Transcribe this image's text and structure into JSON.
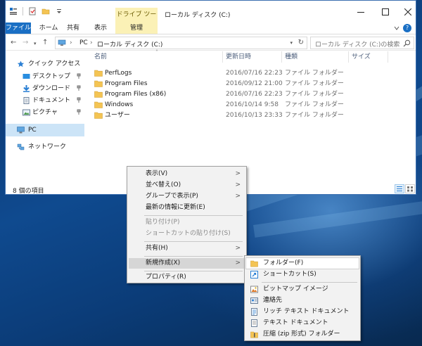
{
  "window": {
    "title": "ローカル ディスク (C:)",
    "contextual_tab": "ドライブ ツール"
  },
  "ribbon": {
    "tabs": [
      "ファイル",
      "ホーム",
      "共有",
      "表示",
      "管理"
    ],
    "help": "?"
  },
  "address": {
    "crumbs": [
      "›",
      "PC",
      "›",
      "ローカル ディスク (C:)"
    ],
    "search_placeholder": "ローカル ディスク (C:)の検索"
  },
  "nav_pane": {
    "items": [
      {
        "label": "クイック アクセス",
        "icon": "star-icon"
      },
      {
        "label": "デスクトップ",
        "icon": "desktop-icon",
        "pinned": true
      },
      {
        "label": "ダウンロード",
        "icon": "download-icon",
        "pinned": true
      },
      {
        "label": "ドキュメント",
        "icon": "document-icon",
        "pinned": true
      },
      {
        "label": "ピクチャ",
        "icon": "pictures-icon",
        "pinned": true
      },
      {
        "label": "PC",
        "icon": "pc-icon",
        "selected": true
      },
      {
        "label": "ネットワーク",
        "icon": "network-icon"
      }
    ]
  },
  "file_list": {
    "columns": [
      "名前",
      "更新日時",
      "種類",
      "サイズ"
    ],
    "rows": [
      {
        "name": "PerfLogs",
        "modified": "2016/07/16 22:23",
        "type": "ファイル フォルダー"
      },
      {
        "name": "Program Files",
        "modified": "2016/09/12 21:00",
        "type": "ファイル フォルダー"
      },
      {
        "name": "Program Files (x86)",
        "modified": "2016/07/16 22:23",
        "type": "ファイル フォルダー"
      },
      {
        "name": "Windows",
        "modified": "2016/10/14 9:58",
        "type": "ファイル フォルダー"
      },
      {
        "name": "ユーザー",
        "modified": "2016/10/13 23:33",
        "type": "ファイル フォルダー"
      }
    ]
  },
  "status": {
    "item_count": "8 個の項目"
  },
  "context_menu": {
    "items": [
      {
        "label": "表示(V)",
        "submenu": true
      },
      {
        "label": "並べ替え(O)",
        "submenu": true
      },
      {
        "label": "グループで表示(P)",
        "submenu": true
      },
      {
        "label": "最新の情報に更新(E)"
      },
      {
        "label": "貼り付け(P)",
        "disabled": true
      },
      {
        "label": "ショートカットの貼り付け(S)",
        "disabled": true
      },
      {
        "label": "共有(H)",
        "submenu": true
      },
      {
        "label": "新規作成(X)",
        "submenu": true,
        "highlighted": true
      },
      {
        "label": "プロパティ(R)"
      }
    ]
  },
  "new_submenu": {
    "items": [
      {
        "label": "フォルダー(F)",
        "icon": "folder-icon",
        "highlighted": true
      },
      {
        "label": "ショートカット(S)",
        "icon": "shortcut-icon"
      },
      {
        "label": "ビットマップ イメージ",
        "icon": "bitmap-icon"
      },
      {
        "label": "連絡先",
        "icon": "contact-icon"
      },
      {
        "label": "リッチ テキスト ドキュメント",
        "icon": "rich-text-icon"
      },
      {
        "label": "テキスト ドキュメント",
        "icon": "text-document-icon"
      },
      {
        "label": "圧縮 (zip 形式) フォルダー",
        "icon": "zip-folder-icon"
      }
    ]
  },
  "colors": {
    "accent": "#1a6fc4",
    "contextual_tab_bg": "#fbf1b6",
    "selection_bg": "#cce4f7",
    "folder": "#f4c453"
  }
}
